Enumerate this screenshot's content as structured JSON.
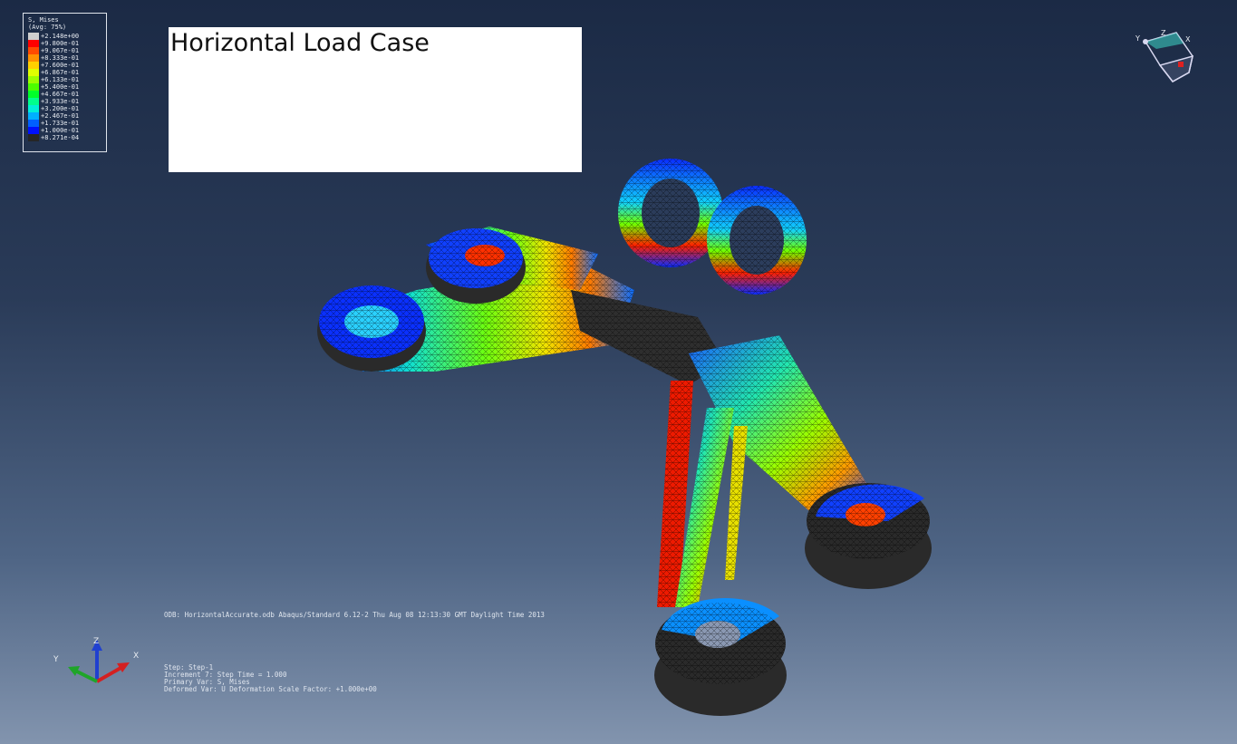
{
  "legend": {
    "title": "S, Mises",
    "subtitle": "(Avg: 75%)",
    "entries": [
      {
        "label": "+2.148e+00",
        "color": "#cfcfcf"
      },
      {
        "label": "+9.800e-01",
        "color": "#ff0000"
      },
      {
        "label": "+9.067e-01",
        "color": "#ff4a00"
      },
      {
        "label": "+8.333e-01",
        "color": "#ff9000"
      },
      {
        "label": "+7.600e-01",
        "color": "#ffd000"
      },
      {
        "label": "+6.867e-01",
        "color": "#e0ff00"
      },
      {
        "label": "+6.133e-01",
        "color": "#9cff00"
      },
      {
        "label": "+5.400e-01",
        "color": "#4cff00"
      },
      {
        "label": "+4.667e-01",
        "color": "#00ff2a"
      },
      {
        "label": "+3.933e-01",
        "color": "#00ff8c"
      },
      {
        "label": "+3.200e-01",
        "color": "#00f0d8"
      },
      {
        "label": "+2.467e-01",
        "color": "#00b0ff"
      },
      {
        "label": "+1.733e-01",
        "color": "#0060ff"
      },
      {
        "label": "+1.000e-01",
        "color": "#0010ff"
      },
      {
        "label": "+8.271e-04",
        "color": "#262626"
      }
    ]
  },
  "title_box": {
    "text": "Horizontal Load Case"
  },
  "odb_line": "ODB: HorizontalAccurate.odb    Abaqus/Standard 6.12-2    Thu Aug 08 12:13:30 GMT Daylight Time 2013",
  "step_info": [
    "Step: Step-1",
    "Increment      7: Step Time =    1.000",
    "Primary Var: S, Mises",
    "Deformed Var: U   Deformation Scale Factor: +1.000e+00"
  ],
  "triad": {
    "x_label": "X",
    "y_label": "Y",
    "z_label": "Z",
    "x_color": "#d42020",
    "y_color": "#1fa52a",
    "z_color": "#2040d0"
  },
  "viewcube": {
    "x_label": "X",
    "y_label": "Y",
    "z_label": "Z"
  }
}
